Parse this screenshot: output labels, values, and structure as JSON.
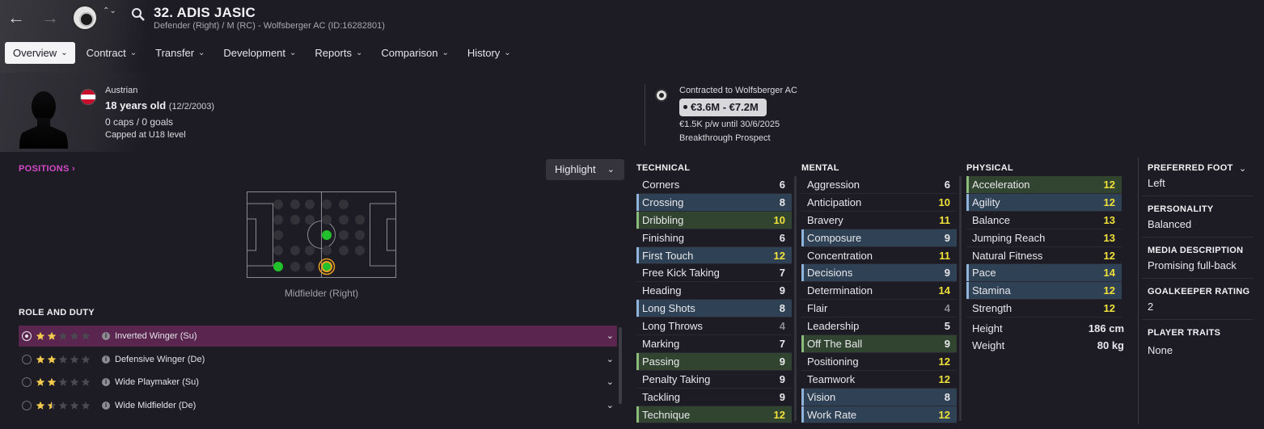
{
  "header": {
    "title": "32. ADIS JASIC",
    "subtitle": "Defender (Right) / M (RC) - Wolfsberger AC (ID:16282801)",
    "back_glyph": "←",
    "forward_glyph": "→",
    "switch_glyph": "⌃⌄"
  },
  "tabs": [
    {
      "label": "Overview",
      "active": true
    },
    {
      "label": "Contract"
    },
    {
      "label": "Transfer"
    },
    {
      "label": "Development"
    },
    {
      "label": "Reports"
    },
    {
      "label": "Comparison"
    },
    {
      "label": "History"
    }
  ],
  "chev": "⌄",
  "profile": {
    "nationality": "Austrian",
    "age": "18 years old",
    "dob": "(12/2/2003)",
    "caps": "0 caps / 0 goals",
    "capped": "Capped at U18 level",
    "flag_colors": [
      "#c8102e",
      "#ffffff",
      "#c8102e"
    ]
  },
  "contract": {
    "contracted_to": "Contracted to Wolfsberger AC",
    "value": "€3.6M - €7.2M",
    "wage": "€1.5K p/w until 30/6/2025",
    "status": "Breakthrough Prospect"
  },
  "positions": {
    "link": "POSITIONS ›",
    "highlight": "Highlight",
    "label": "Midfielder (Right)"
  },
  "roles": {
    "title": "ROLE AND DUTY",
    "items": [
      {
        "name": "Inverted Winger (Su)",
        "stars": 2,
        "selected": true
      },
      {
        "name": "Defensive Winger (De)",
        "stars": 2
      },
      {
        "name": "Wide Playmaker (Su)",
        "stars": 2
      },
      {
        "name": "Wide Midfielder (De)",
        "stars": 1.5
      }
    ]
  },
  "colors": {
    "accent": "#d449c6",
    "value_white": "#e8e8ec",
    "value_yellow": "#f0e23a",
    "value_grey": "#8d8c93",
    "green_dot": "#22c02a",
    "role_orange": "#e8a020",
    "star": "#f2c94c"
  },
  "technical": {
    "title": "TECHNICAL",
    "items": [
      {
        "name": "Corners",
        "value": "6"
      },
      {
        "name": "Crossing",
        "value": "8",
        "hl": "blue"
      },
      {
        "name": "Dribbling",
        "value": "10",
        "hl": "green"
      },
      {
        "name": "Finishing",
        "value": "6"
      },
      {
        "name": "First Touch",
        "value": "12",
        "hl": "blue"
      },
      {
        "name": "Free Kick Taking",
        "value": "7"
      },
      {
        "name": "Heading",
        "value": "9"
      },
      {
        "name": "Long Shots",
        "value": "8",
        "hl": "blue"
      },
      {
        "name": "Long Throws",
        "value": "4"
      },
      {
        "name": "Marking",
        "value": "7"
      },
      {
        "name": "Passing",
        "value": "9",
        "hl": "green"
      },
      {
        "name": "Penalty Taking",
        "value": "9"
      },
      {
        "name": "Tackling",
        "value": "9"
      },
      {
        "name": "Technique",
        "value": "12",
        "hl": "green"
      }
    ]
  },
  "mental": {
    "title": "MENTAL",
    "items": [
      {
        "name": "Aggression",
        "value": "6"
      },
      {
        "name": "Anticipation",
        "value": "10"
      },
      {
        "name": "Bravery",
        "value": "11"
      },
      {
        "name": "Composure",
        "value": "9",
        "hl": "blue"
      },
      {
        "name": "Concentration",
        "value": "11"
      },
      {
        "name": "Decisions",
        "value": "9",
        "hl": "blue"
      },
      {
        "name": "Determination",
        "value": "14"
      },
      {
        "name": "Flair",
        "value": "4"
      },
      {
        "name": "Leadership",
        "value": "5"
      },
      {
        "name": "Off The Ball",
        "value": "9",
        "hl": "green"
      },
      {
        "name": "Positioning",
        "value": "12"
      },
      {
        "name": "Teamwork",
        "value": "12"
      },
      {
        "name": "Vision",
        "value": "8",
        "hl": "blue"
      },
      {
        "name": "Work Rate",
        "value": "12",
        "hl": "blue"
      }
    ]
  },
  "physical": {
    "title": "PHYSICAL",
    "items": [
      {
        "name": "Acceleration",
        "value": "12",
        "hl": "green"
      },
      {
        "name": "Agility",
        "value": "12",
        "hl": "blue"
      },
      {
        "name": "Balance",
        "value": "13"
      },
      {
        "name": "Jumping Reach",
        "value": "13"
      },
      {
        "name": "Natural Fitness",
        "value": "12"
      },
      {
        "name": "Pace",
        "value": "14",
        "hl": "blue"
      },
      {
        "name": "Stamina",
        "value": "12",
        "hl": "blue"
      },
      {
        "name": "Strength",
        "value": "12"
      }
    ],
    "height_label": "Height",
    "height": "186 cm",
    "weight_label": "Weight",
    "weight": "80 kg"
  },
  "side": {
    "preferred_foot_title": "PREFERRED FOOT",
    "preferred_foot": "Left",
    "personality_title": "PERSONALITY",
    "personality": "Balanced",
    "media_title": "MEDIA DESCRIPTION",
    "media": "Promising full-back",
    "gk_title": "GOALKEEPER RATING",
    "gk": "2",
    "traits_title": "PLAYER TRAITS",
    "traits": "None"
  }
}
